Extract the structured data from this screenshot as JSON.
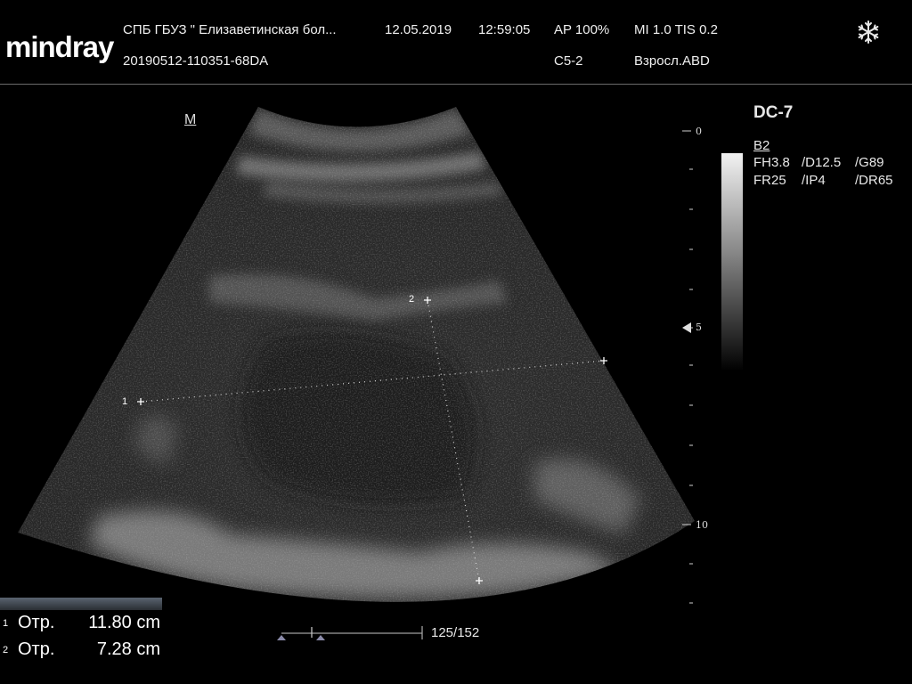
{
  "header": {
    "brand": "mindray",
    "institution": "СПБ  ГБУЗ \" Елизаветинская бол...",
    "date": "12.05.2019",
    "time": "12:59:05",
    "ap": "AP  100%",
    "mi_tis": "MI 1.0 TIS 0.2",
    "exam_id": "20190512-110351-68DA",
    "probe": "C5-2",
    "exam_preset": "Взросл.ABD",
    "freeze_icon": "snowflake-icon"
  },
  "image": {
    "orientation_mark": "M",
    "depth_labels": [
      "0",
      "5",
      "10"
    ],
    "caliper_labels": [
      "1",
      "2"
    ]
  },
  "params": {
    "preset": "DC-7",
    "mode": "B2",
    "row1": [
      "FH3.8",
      "/D12.5",
      "/G89"
    ],
    "row2": [
      "FR25",
      "/IP4",
      "/DR65"
    ]
  },
  "measurements": [
    {
      "index": "1",
      "label": "Отр.",
      "value": "11.80 cm"
    },
    {
      "index": "2",
      "label": "Отр.",
      "value": "7.28 cm"
    }
  ],
  "cine": {
    "frame": "125/152",
    "current": 125,
    "total": 152
  }
}
